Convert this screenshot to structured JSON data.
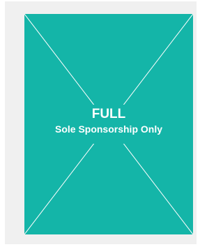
{
  "ad_space": {
    "title": "FULL",
    "subtitle": "Sole Sponsorship Only"
  },
  "colors": {
    "panel": "#14b5a8",
    "frame": "#f0f0f0",
    "text": "#ffffff",
    "lines": "#ffffff"
  }
}
